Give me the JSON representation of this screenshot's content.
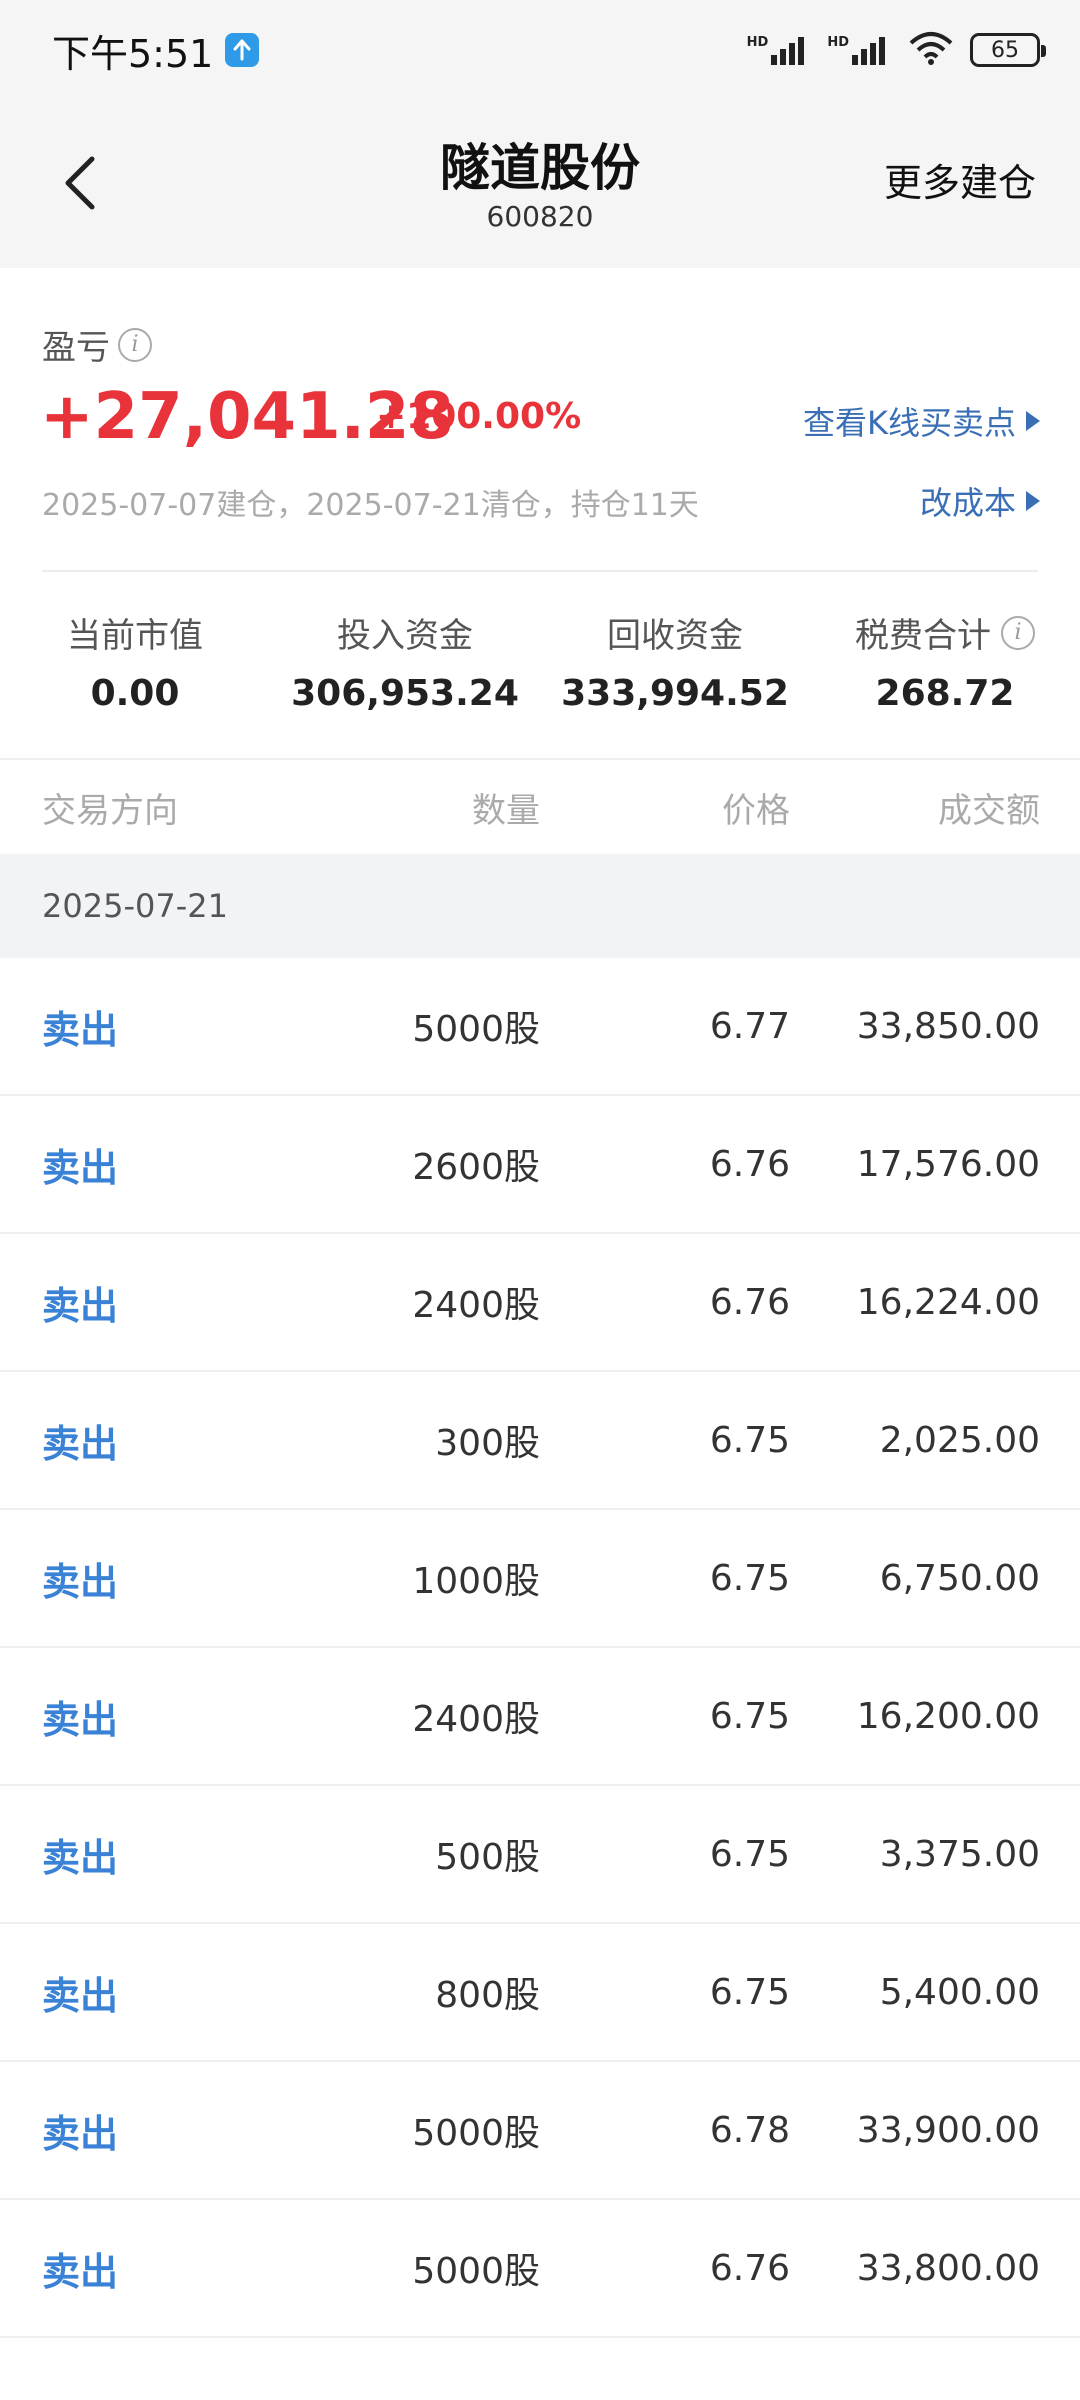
{
  "status_bar": {
    "time": "下午5:51",
    "battery": "65",
    "hd1": "HD",
    "hd2": "HD"
  },
  "nav": {
    "title": "隧道股份",
    "code": "600820",
    "more": "更多建仓"
  },
  "summary": {
    "pl_label": "盈亏",
    "pl_value": "+27,041.28",
    "pl_pct": "+100.00%",
    "kline_link": "查看K线买卖点",
    "dates": "2025-07-07建仓，2025-07-21清仓，持仓11天",
    "cost_link": "改成本",
    "stats": [
      {
        "label": "当前市值",
        "value": "0.00"
      },
      {
        "label": "投入资金",
        "value": "306,953.24"
      },
      {
        "label": "回收资金",
        "value": "333,994.52"
      },
      {
        "label": "税费合计",
        "value": "268.72"
      }
    ]
  },
  "table": {
    "headers": {
      "direction": "交易方向",
      "quantity": "数量",
      "price": "价格",
      "amount": "成交额"
    },
    "group_date": "2025-07-21",
    "rows": [
      {
        "direction": "卖出",
        "quantity": "5000股",
        "price": "6.77",
        "amount": "33,850.00"
      },
      {
        "direction": "卖出",
        "quantity": "2600股",
        "price": "6.76",
        "amount": "17,576.00"
      },
      {
        "direction": "卖出",
        "quantity": "2400股",
        "price": "6.76",
        "amount": "16,224.00"
      },
      {
        "direction": "卖出",
        "quantity": "300股",
        "price": "6.75",
        "amount": "2,025.00"
      },
      {
        "direction": "卖出",
        "quantity": "1000股",
        "price": "6.75",
        "amount": "6,750.00"
      },
      {
        "direction": "卖出",
        "quantity": "2400股",
        "price": "6.75",
        "amount": "16,200.00"
      },
      {
        "direction": "卖出",
        "quantity": "500股",
        "price": "6.75",
        "amount": "3,375.00"
      },
      {
        "direction": "卖出",
        "quantity": "800股",
        "price": "6.75",
        "amount": "5,400.00"
      },
      {
        "direction": "卖出",
        "quantity": "5000股",
        "price": "6.78",
        "amount": "33,900.00"
      },
      {
        "direction": "卖出",
        "quantity": "5000股",
        "price": "6.76",
        "amount": "33,800.00"
      }
    ]
  }
}
